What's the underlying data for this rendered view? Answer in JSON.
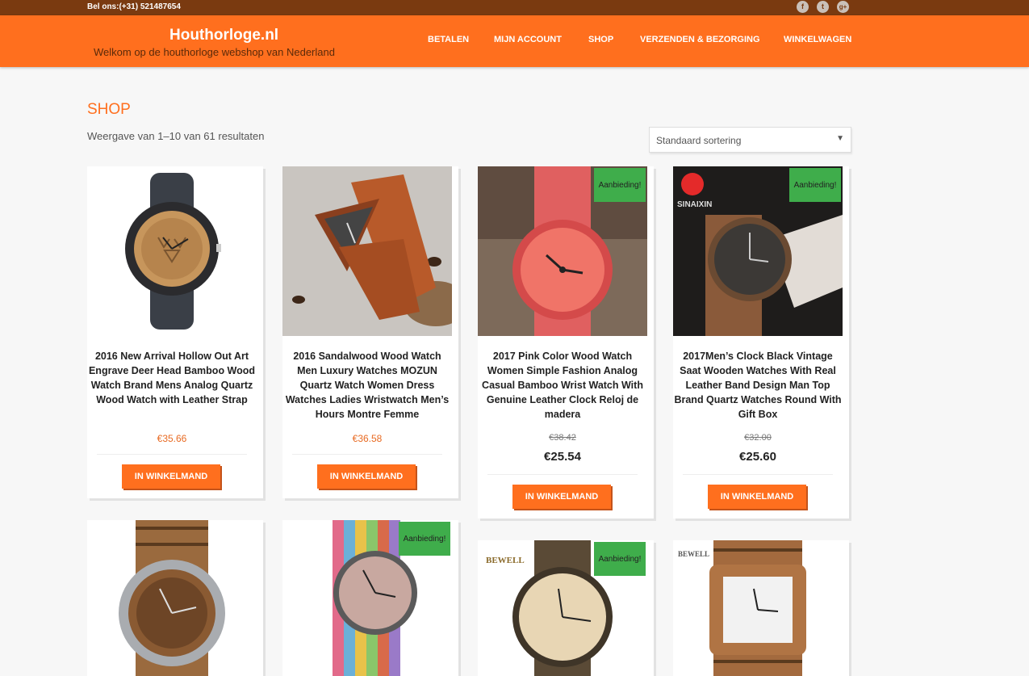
{
  "topbar": {
    "phone": "Bel ons:(+31) 521487654",
    "social": [
      "facebook-icon",
      "twitter-icon",
      "google-plus-icon"
    ]
  },
  "site": {
    "title": "Houthorloge.nl",
    "tagline": "Welkom op de houthorloge webshop van Nederland"
  },
  "nav": [
    "BETALEN",
    "MIJN ACCOUNT",
    "SHOP",
    "VERZENDEN & BEZORGING",
    "WINKELWAGEN"
  ],
  "shop": {
    "title": "SHOP",
    "result_count": "Weergave van 1–10 van 61 resultaten",
    "sort_selected": "Standaard sortering"
  },
  "button_label": "IN WINKELMAND",
  "badge_label": "Aanbieding!",
  "products": [
    {
      "title": "2016 New Arrival Hollow Out Art Engrave Deer Head Bamboo Wood Watch Brand Mens Analog Quartz Wood Watch with Leather Strap",
      "price": "€35.66",
      "sale": false
    },
    {
      "title": "2016 Sandalwood Wood Watch Men Luxury Watches MOZUN Quartz Watch Women Dress Watches Ladies Wristwatch Men’s Hours Montre Femme",
      "price": "€36.58",
      "sale": false
    },
    {
      "title": "2017 Pink Color Wood Watch Women Simple Fashion Analog Casual Bamboo Wrist Watch With Genuine Leather Clock Reloj de madera",
      "old_price": "€38.42",
      "price": "€25.54",
      "sale": true
    },
    {
      "title": "2017Men’s Clock Black Vintage Saat Wooden Watches With Real Leather Band Design Man Top Brand Quartz Watches Round With Gift Box",
      "old_price": "€32.00",
      "price": "€25.60",
      "sale": true
    },
    {
      "title": "",
      "price": "",
      "sale": false
    },
    {
      "title": "",
      "price": "",
      "sale": true
    },
    {
      "title": "",
      "price": "",
      "sale": true,
      "brand": "BEWELL"
    },
    {
      "title": "",
      "price": "",
      "sale": false,
      "brand": "BEWELL"
    }
  ],
  "colors": {
    "accent": "#ff6f1e",
    "topbar": "#7a3a10",
    "sale_badge": "#3fad4b"
  }
}
